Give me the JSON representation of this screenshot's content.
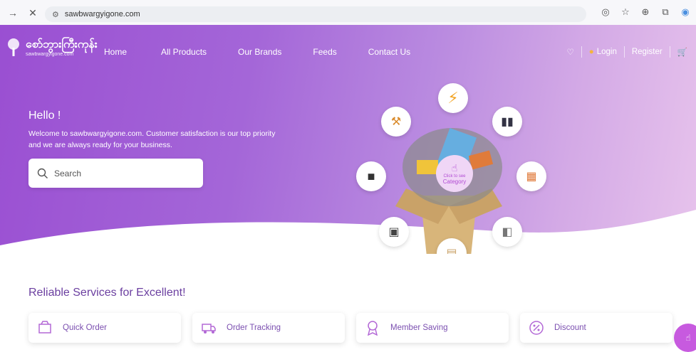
{
  "browser": {
    "url": "sawbwargyigone.com",
    "back_icon": "arrow-right-icon",
    "close_icon": "close-icon"
  },
  "site": {
    "logo": {
      "title": "စော်ဘွားကြီးကုန်း",
      "subtitle": "sawbwargyigone.com"
    },
    "nav": [
      "Home",
      "All Products",
      "Our Brands",
      "Feeds",
      "Contact Us"
    ],
    "user": {
      "login": "Login",
      "register": "Register"
    },
    "hero": {
      "greeting": "Hello !",
      "welcome_line1": "Welcome to sawbwargyigone.com. Customer satisfaction is our top priority",
      "welcome_line2": "and we are always ready for your business.",
      "search_placeholder": "Search",
      "category_small": "Click to see",
      "category_label": "Category"
    },
    "services": {
      "title": "Reliable Services for Excellent!",
      "cards": [
        "Quick Order",
        "Order Tracking",
        "Member Saving",
        "Discount"
      ]
    },
    "colors": {
      "accent": "#a05bd6",
      "text": "#6b3fa0"
    }
  }
}
